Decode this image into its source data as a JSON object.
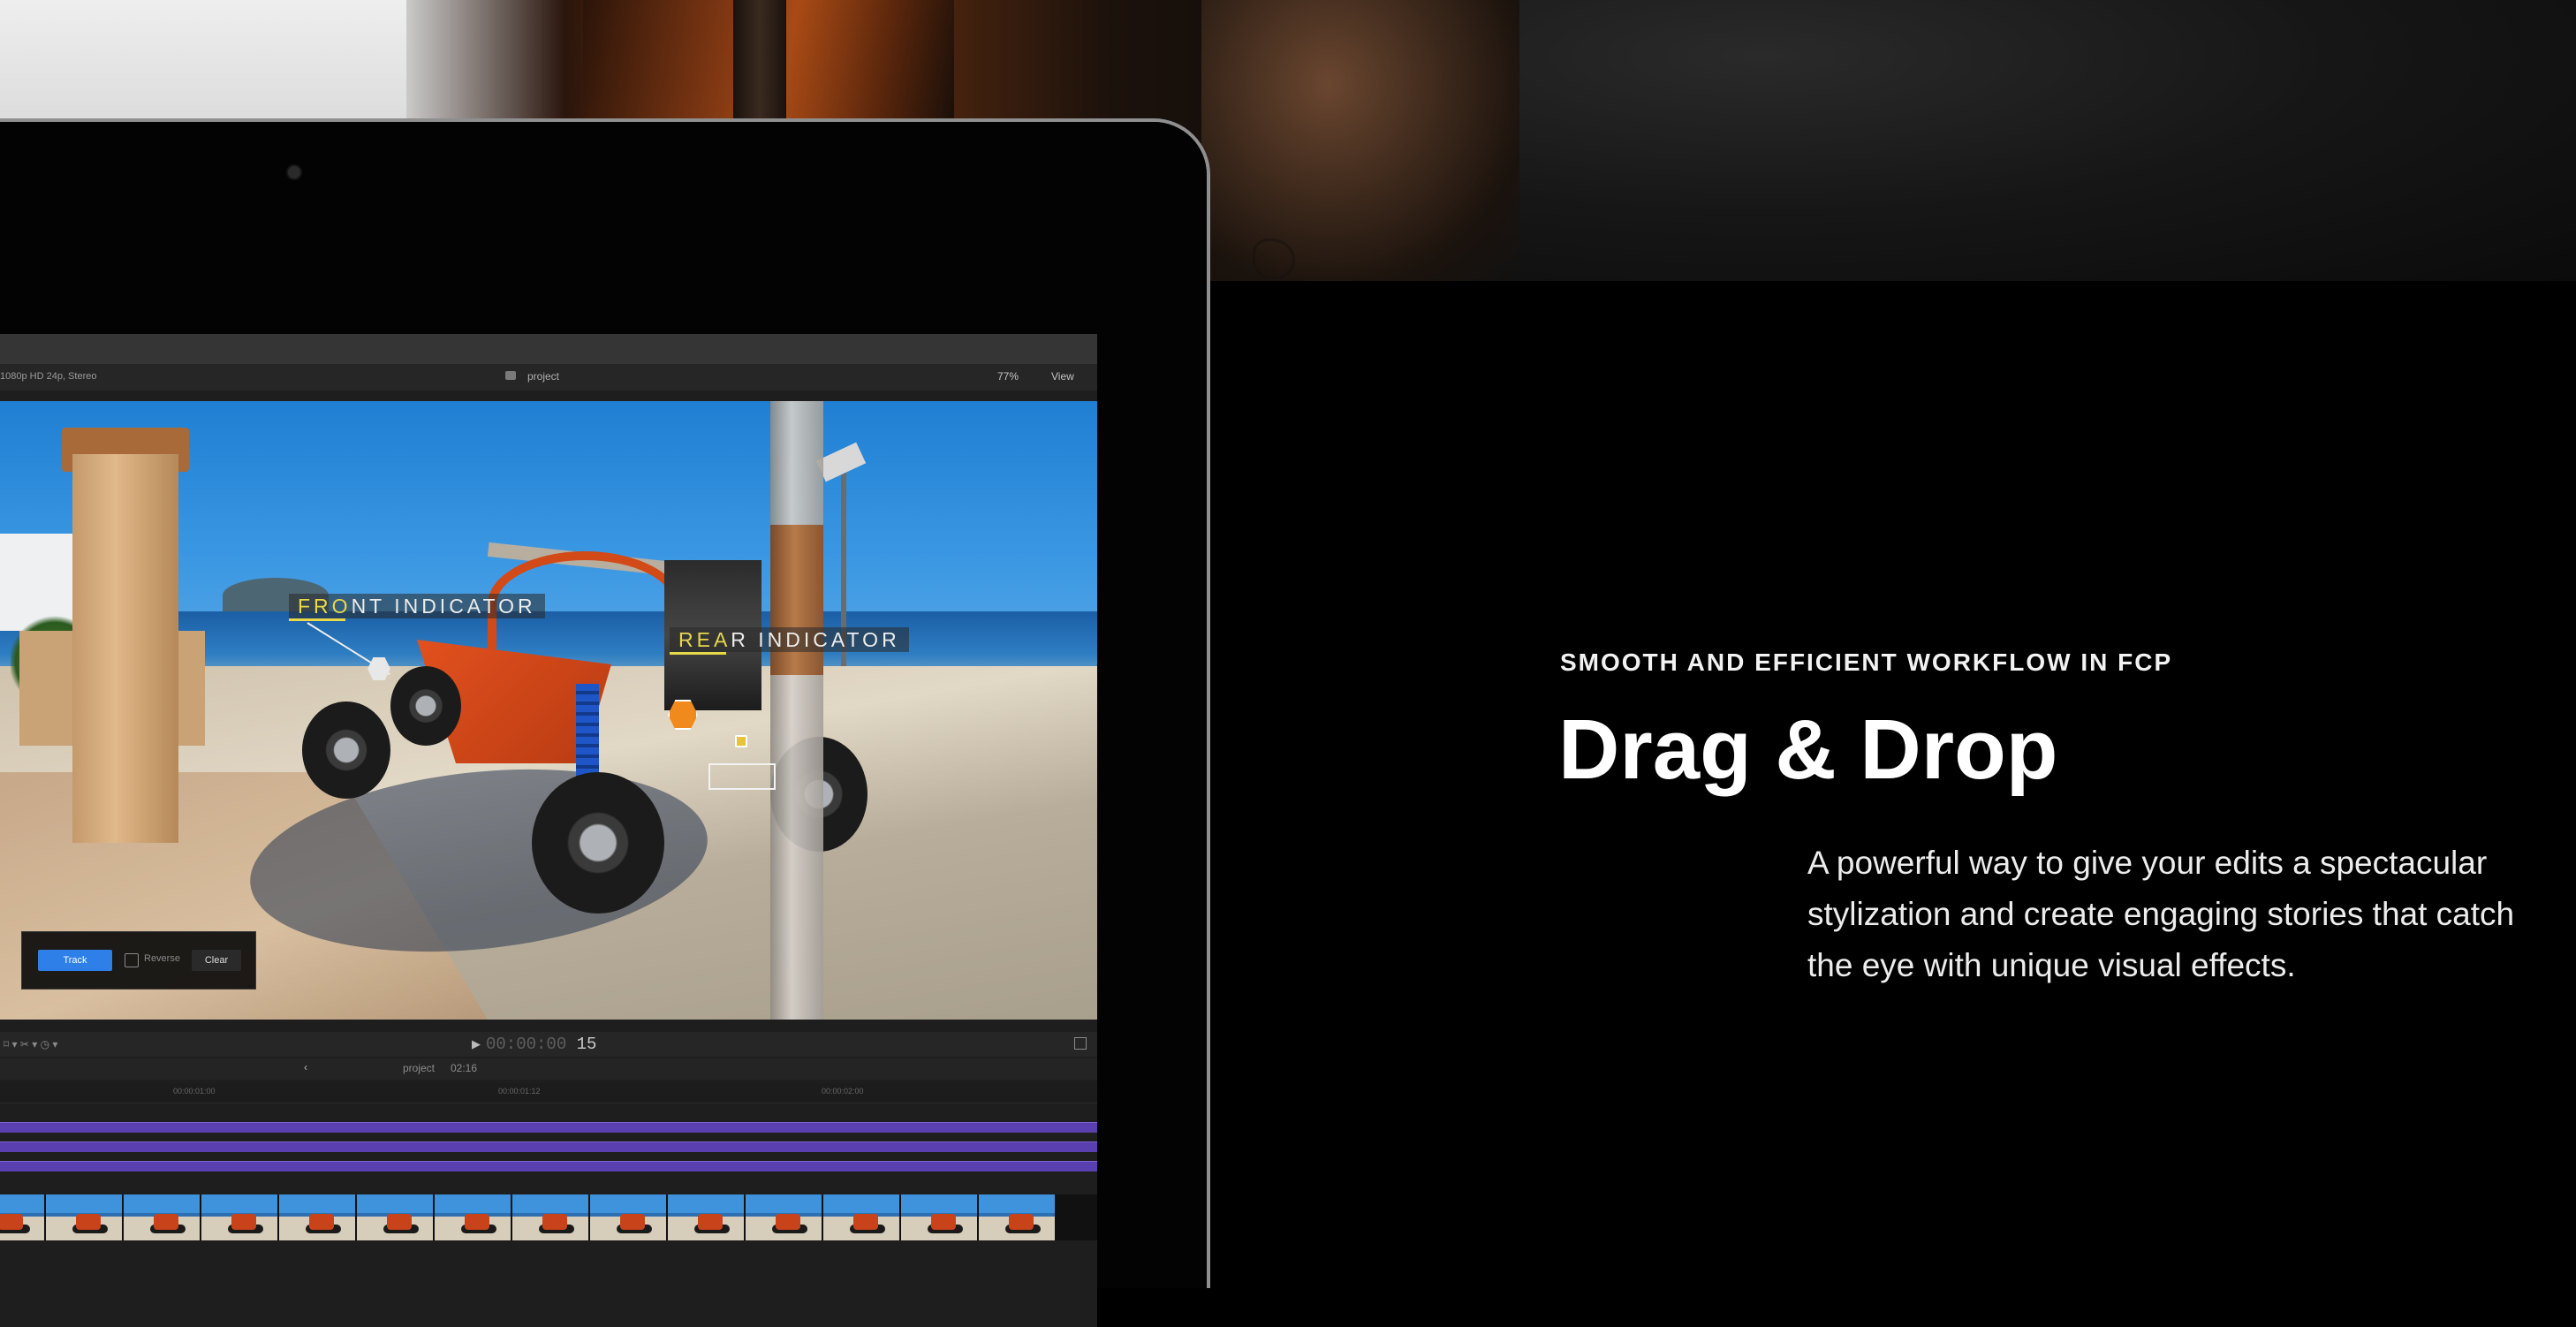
{
  "editor": {
    "format_label": "1080p HD 24p, Stereo",
    "project_title": "project",
    "zoom_level": "77%",
    "view_menu": "View",
    "overlays": {
      "front_indicator_highlight": "FRO",
      "front_indicator_rest": "NT INDICATOR",
      "rear_indicator_highlight": "REA",
      "rear_indicator_rest": "R INDICATOR"
    },
    "tracker": {
      "track_button": "Track",
      "reverse_label": "Reverse",
      "clear_button": "Clear"
    },
    "transport": {
      "tools": "⌑ ▾   ✂ ▾   ◷ ▾",
      "play": "▶",
      "timecode_dim": "00:00:00",
      "timecode_frames": "15"
    },
    "timeline": {
      "back": "‹",
      "project_name": "project",
      "duration": "02:16",
      "ruler_marks": [
        "00:00:01:00",
        "00:00:01:12",
        "00:00:02:00"
      ]
    },
    "filmstrip_frames": 14,
    "purple_tracks": 3
  },
  "hero": {
    "eyebrow": "SMOOTH AND EFFICIENT WORKFLOW IN FCP",
    "headline": "Drag & Drop",
    "body": "A powerful way to give your edits a spectacular stylization and create engaging stories that catch the eye with unique visual effects."
  },
  "colors": {
    "accent_blue": "#2e7fe8",
    "indicator_yellow": "#e7d84a",
    "timeline_purple": "#5a3fb0",
    "page_background": "#000000"
  }
}
